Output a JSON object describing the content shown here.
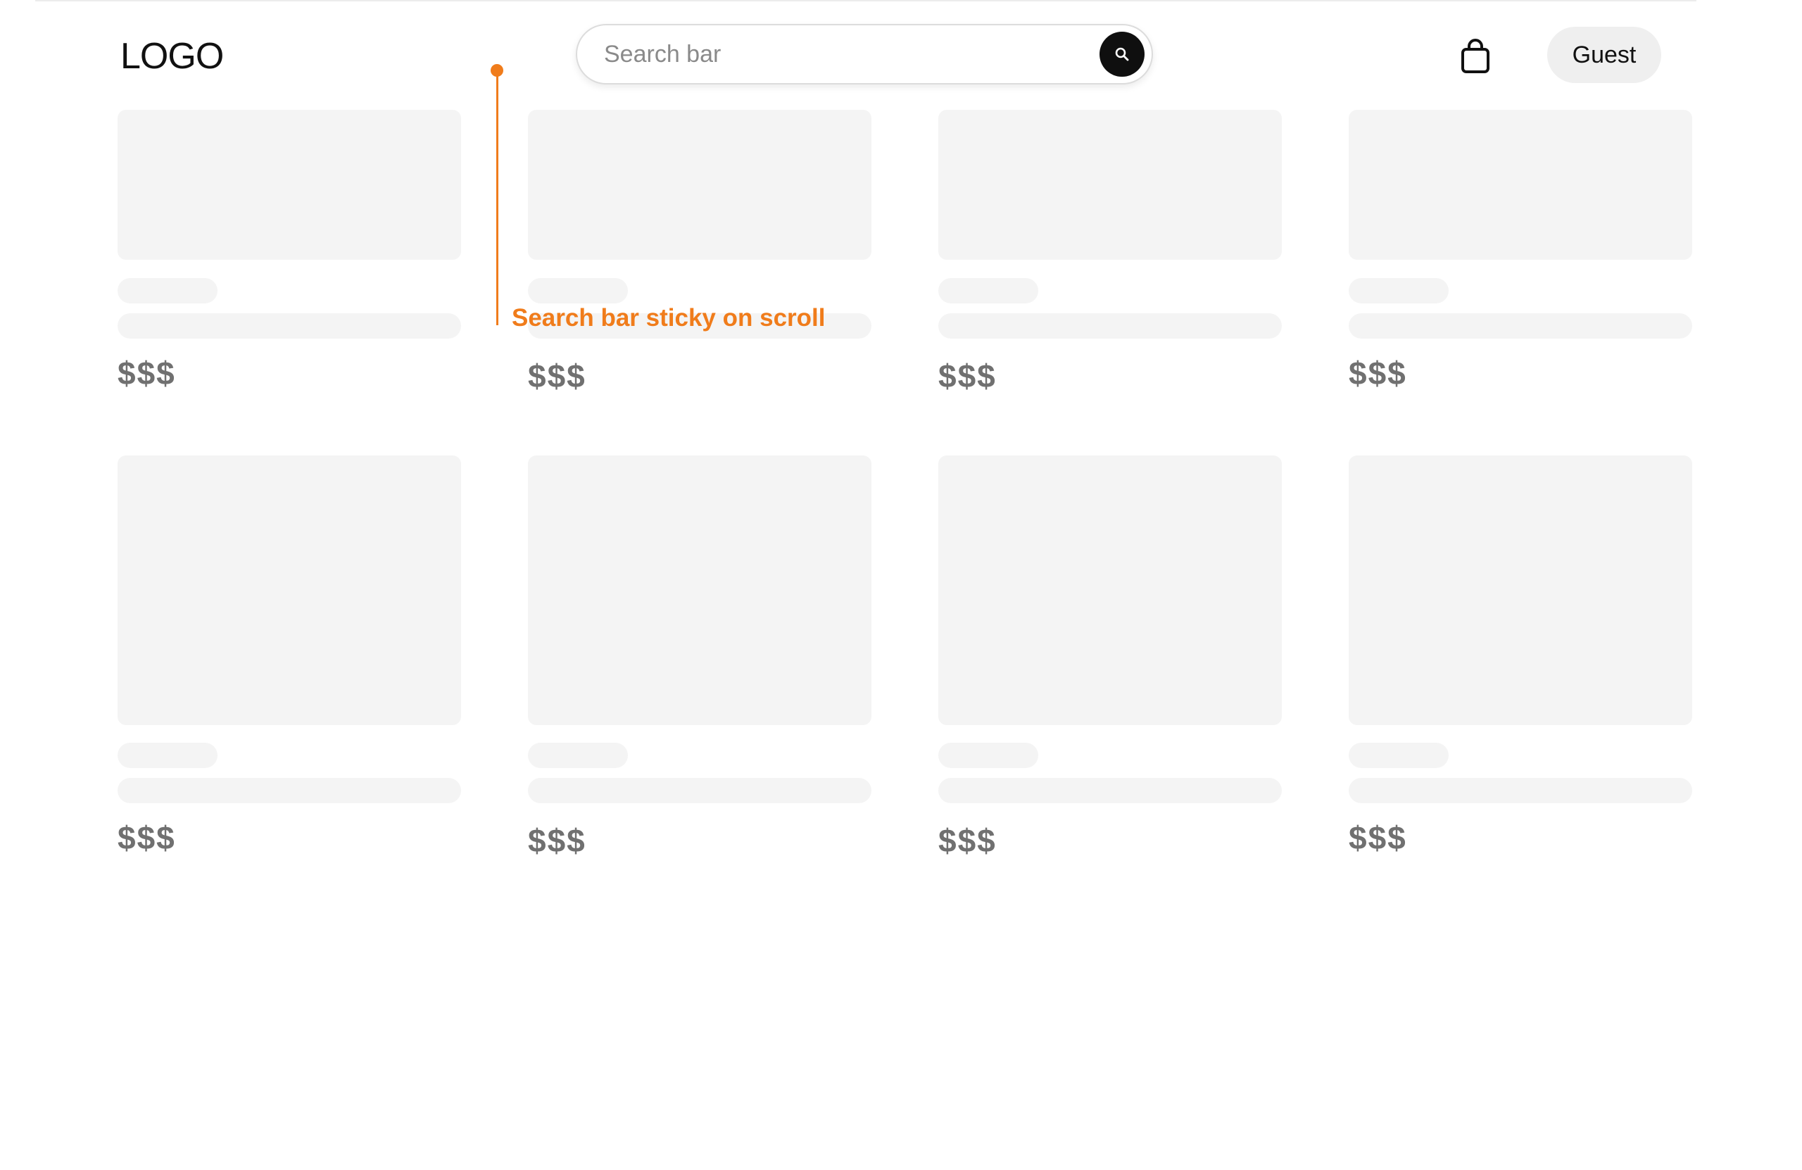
{
  "header": {
    "logo": "LOGO",
    "search": {
      "placeholder": "Search bar"
    },
    "icons": {
      "search": "search-icon",
      "cart": "shopping-bag-icon"
    },
    "guest_label": "Guest"
  },
  "products": [
    {
      "price": "$$$"
    },
    {
      "price": "$$$"
    },
    {
      "price": "$$$"
    },
    {
      "price": "$$$"
    },
    {
      "price": "$$$"
    },
    {
      "price": "$$$"
    },
    {
      "price": "$$$"
    },
    {
      "price": "$$$"
    }
  ],
  "annotation": {
    "text": "Search bar sticky on scroll",
    "color": "#f07c1b"
  },
  "colors": {
    "placeholder": "#f4f4f4",
    "price": "#707070",
    "search_button": "#0f0f0f",
    "guest_button": "#efefef"
  }
}
